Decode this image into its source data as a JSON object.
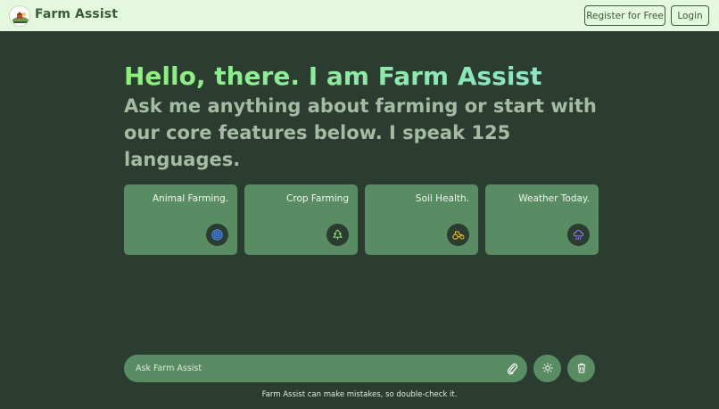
{
  "header": {
    "brand": "Farm Assist",
    "logo_icon": "farm-logo-icon",
    "register_label": "Register for Free",
    "login_label": "Login"
  },
  "hero": {
    "title": "Hello, there. I am Farm Assist",
    "subtitle": "Ask me anything about farming or start with our core features below. I speak 125 languages."
  },
  "cards": [
    {
      "label": "Animal Farming.",
      "icon": "target-icon",
      "icon_color": "#4f8bff"
    },
    {
      "label": "Crop Farming",
      "icon": "tree-icon",
      "icon_color": "#8fdf85"
    },
    {
      "label": "Soil Health.",
      "icon": "tractor-icon",
      "icon_color": "#f1c232"
    },
    {
      "label": "Weather Today.",
      "icon": "cloud-rain-icon",
      "icon_color": "#9c7dff"
    }
  ],
  "prompt": {
    "placeholder": "Ask Farm Assist",
    "attach_icon": "paperclip-icon",
    "theme_icon": "sun-icon",
    "clear_icon": "trash-icon"
  },
  "footer": {
    "disclaimer": "Farm Assist can make mistakes, so double-check it."
  },
  "colors": {
    "background": "#2b3d30",
    "header_bg": "#e3f8dc",
    "card_bg": "#5a8c63",
    "brand_text": "#3b5a38"
  }
}
